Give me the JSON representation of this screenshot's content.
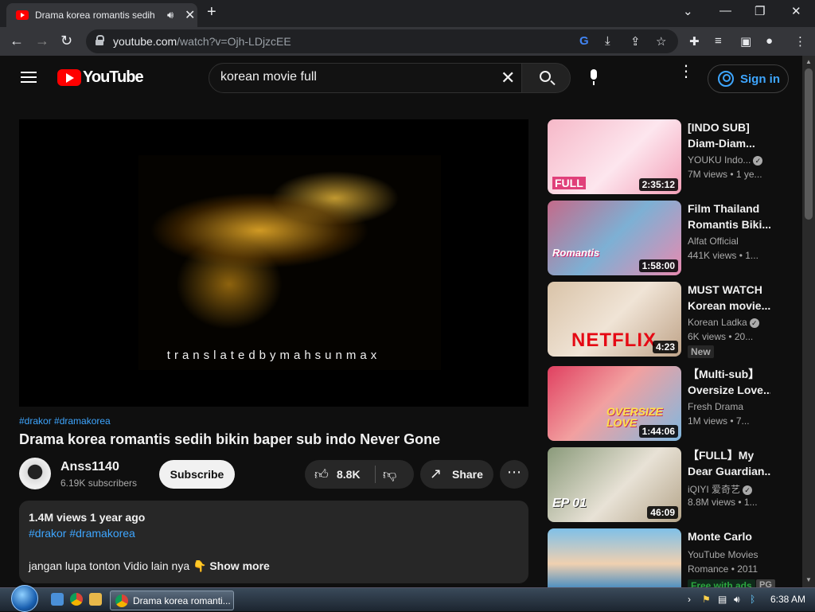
{
  "browser": {
    "tab_title": "Drama korea romantis sedih",
    "new_tab_glyph": "+",
    "url_host": "youtube.com",
    "url_path": "/watch?v=Ojh-LDjzcEE"
  },
  "youtube": {
    "logo_text": "YouTube",
    "search_value": "korean movie full",
    "sign_in_label": "Sign in"
  },
  "video": {
    "caption": "translatedbymahsunmax",
    "hashtags": "#drakor #dramakorea",
    "title": "Drama korea romantis sedih bikin baper sub indo Never Gone",
    "channel_name": "Anss1140",
    "subscribers": "6.19K subscribers",
    "subscribe_label": "Subscribe",
    "likes": "8.8K",
    "share_label": "Share",
    "description": {
      "views": "1.4M views",
      "age": "1 year ago",
      "tags": "#drakor #dramakorea",
      "text": "jangan lupa tonton Vidio lain nya 👇",
      "show_more": "Show more"
    }
  },
  "recommendations": [
    {
      "line1": "[INDO SUB]",
      "line2": "Diam-Diam...",
      "channel": "YOUKU Indo...",
      "verified": true,
      "meta": "7M views • 1 ye...",
      "duration": "2:35:12",
      "thumb_text": "FULL"
    },
    {
      "line1": "Film Thailand",
      "line2": "Romantis Biki...",
      "channel": "Alfat Official",
      "verified": false,
      "meta": "441K views • 1...",
      "duration": "1:58:00",
      "thumb_text": "Romantis"
    },
    {
      "line1": "MUST WATCH",
      "line2": "Korean movie...",
      "channel": "Korean Ladka",
      "verified": true,
      "meta": "6K views • 20...",
      "duration": "4:23",
      "badge": "New",
      "thumb_text": "NETFLIX"
    },
    {
      "line1": "【Multi-sub】",
      "line2": "Oversize Love...",
      "channel": "Fresh Drama",
      "verified": false,
      "meta": "1M views • 7...",
      "duration": "1:44:06",
      "thumb_text": "OVERSIZE LOVE"
    },
    {
      "line1": "【FULL】My",
      "line2": "Dear Guardian...",
      "channel": "iQIYI 爱奇艺",
      "verified": true,
      "meta": "8.8M views • 1...",
      "duration": "46:09",
      "thumb_text": "EP 01"
    },
    {
      "line1": "Monte Carlo",
      "line2": "",
      "channel": "YouTube Movies",
      "verified": false,
      "meta": "Romance • 2011",
      "badge_green": "Free with ads",
      "badge2": "PG",
      "thumb_text": ""
    }
  ],
  "taskbar": {
    "task_label": "Drama korea romanti...",
    "clock": "6:38 AM"
  },
  "colors": {
    "background": "#0f0f0f",
    "accent_blue": "#3ea6ff",
    "youtube_red": "#ff0000"
  }
}
